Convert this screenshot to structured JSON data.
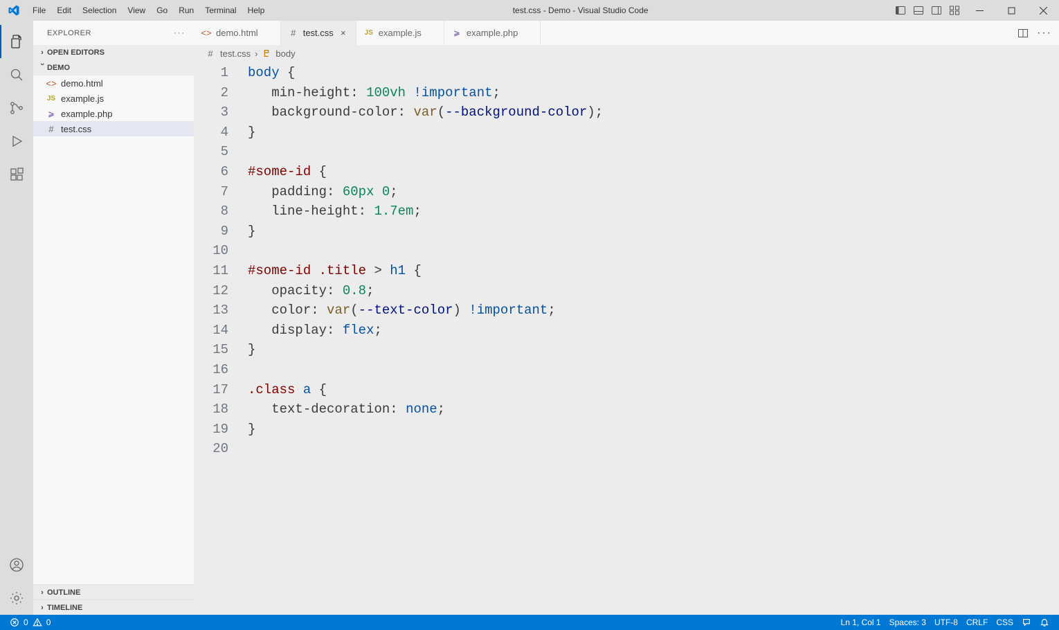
{
  "window": {
    "title": "test.css - Demo - Visual Studio Code"
  },
  "menu": [
    "File",
    "Edit",
    "Selection",
    "View",
    "Go",
    "Run",
    "Terminal",
    "Help"
  ],
  "explorer": {
    "title": "EXPLORER",
    "sections": {
      "openEditors": "OPEN EDITORS",
      "folder": "DEMO",
      "outline": "OUTLINE",
      "timeline": "TIMELINE"
    },
    "files": [
      {
        "name": "demo.html",
        "icon": "html"
      },
      {
        "name": "example.js",
        "icon": "js"
      },
      {
        "name": "example.php",
        "icon": "php"
      },
      {
        "name": "test.css",
        "icon": "css",
        "active": true
      }
    ]
  },
  "tabs": [
    {
      "label": "demo.html",
      "icon": "html"
    },
    {
      "label": "test.css",
      "icon": "css",
      "active": true
    },
    {
      "label": "example.js",
      "icon": "js"
    },
    {
      "label": "example.php",
      "icon": "php"
    }
  ],
  "breadcrumbs": {
    "file": "test.css",
    "symbol": "body"
  },
  "code": {
    "lines": [
      [
        {
          "t": "body",
          "c": "tok-body"
        },
        {
          "t": " "
        },
        {
          "t": "{",
          "c": "tok-brace"
        }
      ],
      [
        {
          "t": "   "
        },
        {
          "t": "min-height",
          "c": "tok-prop"
        },
        {
          "t": ": "
        },
        {
          "t": "100vh",
          "c": "tok-num"
        },
        {
          "t": " "
        },
        {
          "t": "!important",
          "c": "tok-imp"
        },
        {
          "t": ";",
          "c": "tok-punct"
        }
      ],
      [
        {
          "t": "   "
        },
        {
          "t": "background-color",
          "c": "tok-prop"
        },
        {
          "t": ": "
        },
        {
          "t": "var",
          "c": "tok-func"
        },
        {
          "t": "("
        },
        {
          "t": "--background-color",
          "c": "tok-var"
        },
        {
          "t": ")"
        },
        {
          "t": ";",
          "c": "tok-punct"
        }
      ],
      [
        {
          "t": "}",
          "c": "tok-brace"
        }
      ],
      [],
      [
        {
          "t": "#some-id",
          "c": "tok-id"
        },
        {
          "t": " "
        },
        {
          "t": "{",
          "c": "tok-brace"
        }
      ],
      [
        {
          "t": "   "
        },
        {
          "t": "padding",
          "c": "tok-prop"
        },
        {
          "t": ": "
        },
        {
          "t": "60px",
          "c": "tok-num"
        },
        {
          "t": " "
        },
        {
          "t": "0",
          "c": "tok-num"
        },
        {
          "t": ";",
          "c": "tok-punct"
        }
      ],
      [
        {
          "t": "   "
        },
        {
          "t": "line-height",
          "c": "tok-prop"
        },
        {
          "t": ": "
        },
        {
          "t": "1.7em",
          "c": "tok-num"
        },
        {
          "t": ";",
          "c": "tok-punct"
        }
      ],
      [
        {
          "t": "}",
          "c": "tok-brace"
        }
      ],
      [],
      [
        {
          "t": "#some-id",
          "c": "tok-id"
        },
        {
          "t": " "
        },
        {
          "t": ".title",
          "c": "tok-classsel"
        },
        {
          "t": " > ",
          "c": "tok-punct"
        },
        {
          "t": "h1",
          "c": "tok-h1"
        },
        {
          "t": " "
        },
        {
          "t": "{",
          "c": "tok-brace"
        }
      ],
      [
        {
          "t": "   "
        },
        {
          "t": "opacity",
          "c": "tok-prop"
        },
        {
          "t": ": "
        },
        {
          "t": "0.8",
          "c": "tok-num"
        },
        {
          "t": ";",
          "c": "tok-punct"
        }
      ],
      [
        {
          "t": "   "
        },
        {
          "t": "color",
          "c": "tok-prop"
        },
        {
          "t": ": "
        },
        {
          "t": "var",
          "c": "tok-func"
        },
        {
          "t": "("
        },
        {
          "t": "--text-color",
          "c": "tok-var"
        },
        {
          "t": ")"
        },
        {
          "t": " "
        },
        {
          "t": "!important",
          "c": "tok-imp"
        },
        {
          "t": ";",
          "c": "tok-punct"
        }
      ],
      [
        {
          "t": "   "
        },
        {
          "t": "display",
          "c": "tok-prop"
        },
        {
          "t": ": "
        },
        {
          "t": "flex",
          "c": "tok-const"
        },
        {
          "t": ";",
          "c": "tok-punct"
        }
      ],
      [
        {
          "t": "}",
          "c": "tok-brace"
        }
      ],
      [],
      [
        {
          "t": ".class",
          "c": "tok-classsel"
        },
        {
          "t": " "
        },
        {
          "t": "a",
          "c": "tok-a"
        },
        {
          "t": " "
        },
        {
          "t": "{",
          "c": "tok-brace"
        }
      ],
      [
        {
          "t": "   "
        },
        {
          "t": "text-decoration",
          "c": "tok-prop"
        },
        {
          "t": ": "
        },
        {
          "t": "none",
          "c": "tok-const"
        },
        {
          "t": ";",
          "c": "tok-punct"
        }
      ],
      [
        {
          "t": "}",
          "c": "tok-brace"
        }
      ],
      []
    ]
  },
  "status": {
    "errors": "0",
    "warnings": "0",
    "lncol": "Ln 1, Col 1",
    "spaces": "Spaces: 3",
    "encoding": "UTF-8",
    "eol": "CRLF",
    "lang": "CSS"
  }
}
